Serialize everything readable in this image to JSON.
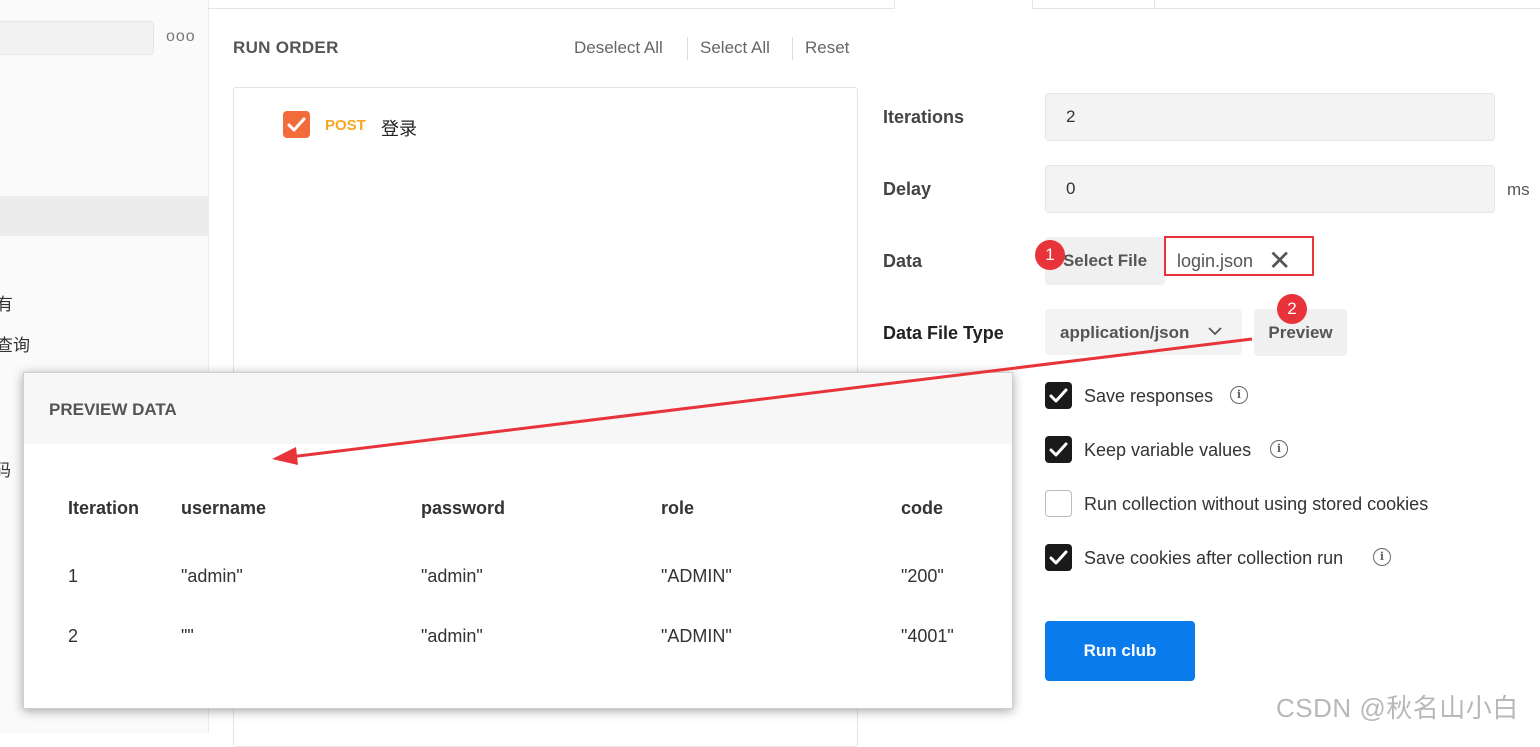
{
  "sidebar": {
    "more_label": "ooo",
    "items": [
      {
        "label": "有"
      },
      {
        "label": "查询"
      },
      {
        "label": "码"
      }
    ]
  },
  "run_order": {
    "title": "RUN ORDER",
    "deselect_all": "Deselect All",
    "select_all": "Select All",
    "reset": "Reset",
    "requests": [
      {
        "method": "POST",
        "name": "登录",
        "checked": true
      }
    ]
  },
  "settings": {
    "iterations_label": "Iterations",
    "iterations_value": "2",
    "delay_label": "Delay",
    "delay_value": "0",
    "delay_unit": "ms",
    "data_label": "Data",
    "select_file_label": "Select File",
    "file_name": "login.json",
    "data_file_type_label": "Data File Type",
    "data_file_type_value": "application/json",
    "preview_label": "Preview",
    "options": [
      {
        "label": "Save responses",
        "checked": true,
        "info": true
      },
      {
        "label": "Keep variable values",
        "checked": true,
        "info": true
      },
      {
        "label": "Run collection without using stored cookies",
        "checked": false,
        "info": false
      },
      {
        "label": "Save cookies after collection run",
        "checked": true,
        "info": true
      }
    ],
    "run_button": "Run club"
  },
  "annotations": {
    "badge_1": "1",
    "badge_2": "2",
    "color": "#e8333a"
  },
  "preview_modal": {
    "title": "PREVIEW DATA",
    "columns": [
      "Iteration",
      "username",
      "password",
      "role",
      "code"
    ],
    "rows": [
      [
        "1",
        "\"admin\"",
        "\"admin\"",
        "\"ADMIN\"",
        "\"200\""
      ],
      [
        "2",
        "\"\"",
        "\"admin\"",
        "\"ADMIN\"",
        "\"4001\""
      ]
    ]
  },
  "watermark": "CSDN @秋名山小白",
  "colors": {
    "accent_orange": "#f26b3a",
    "method_post": "#f5a623",
    "run_button": "#097bed",
    "highlight_red": "#e8333a"
  }
}
